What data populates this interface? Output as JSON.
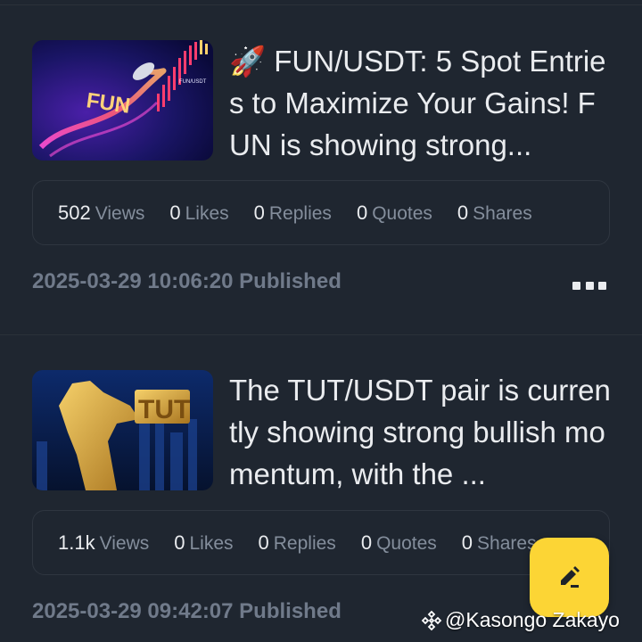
{
  "posts": [
    {
      "text": "🚀 FUN/USDT: 5 Spot Entries to Maximize Your Gains! FUN is showing strong...",
      "thumbnail": {
        "label": "FUN",
        "sublabel": "FUN/USDT"
      },
      "stats": {
        "views": "502",
        "views_label": "Views",
        "likes": "0",
        "likes_label": "Likes",
        "replies": "0",
        "replies_label": "Replies",
        "quotes": "0",
        "quotes_label": "Quotes",
        "shares": "0",
        "shares_label": "Shares"
      },
      "published": "2025-03-29 10:06:20 Published"
    },
    {
      "text": "The TUT/USDT pair is currently showing strong bullish momentum, with the ...",
      "thumbnail": {
        "label": "TUT"
      },
      "stats": {
        "views": "1.1k",
        "views_label": "Views",
        "likes": "0",
        "likes_label": "Likes",
        "replies": "0",
        "replies_label": "Replies",
        "quotes": "0",
        "quotes_label": "Quotes",
        "shares": "0",
        "shares_label": "Shares"
      },
      "published": "2025-03-29 09:42:07 Published"
    }
  ],
  "watermark": "@Kasongo Zakayo",
  "icons": {
    "more": "more-horizontal-icon",
    "fab": "edit-pen-icon",
    "watermark": "binance-diamond-icon"
  },
  "colors": {
    "background": "#1f2630",
    "accent": "#fcd535",
    "muted": "#848e9c"
  }
}
